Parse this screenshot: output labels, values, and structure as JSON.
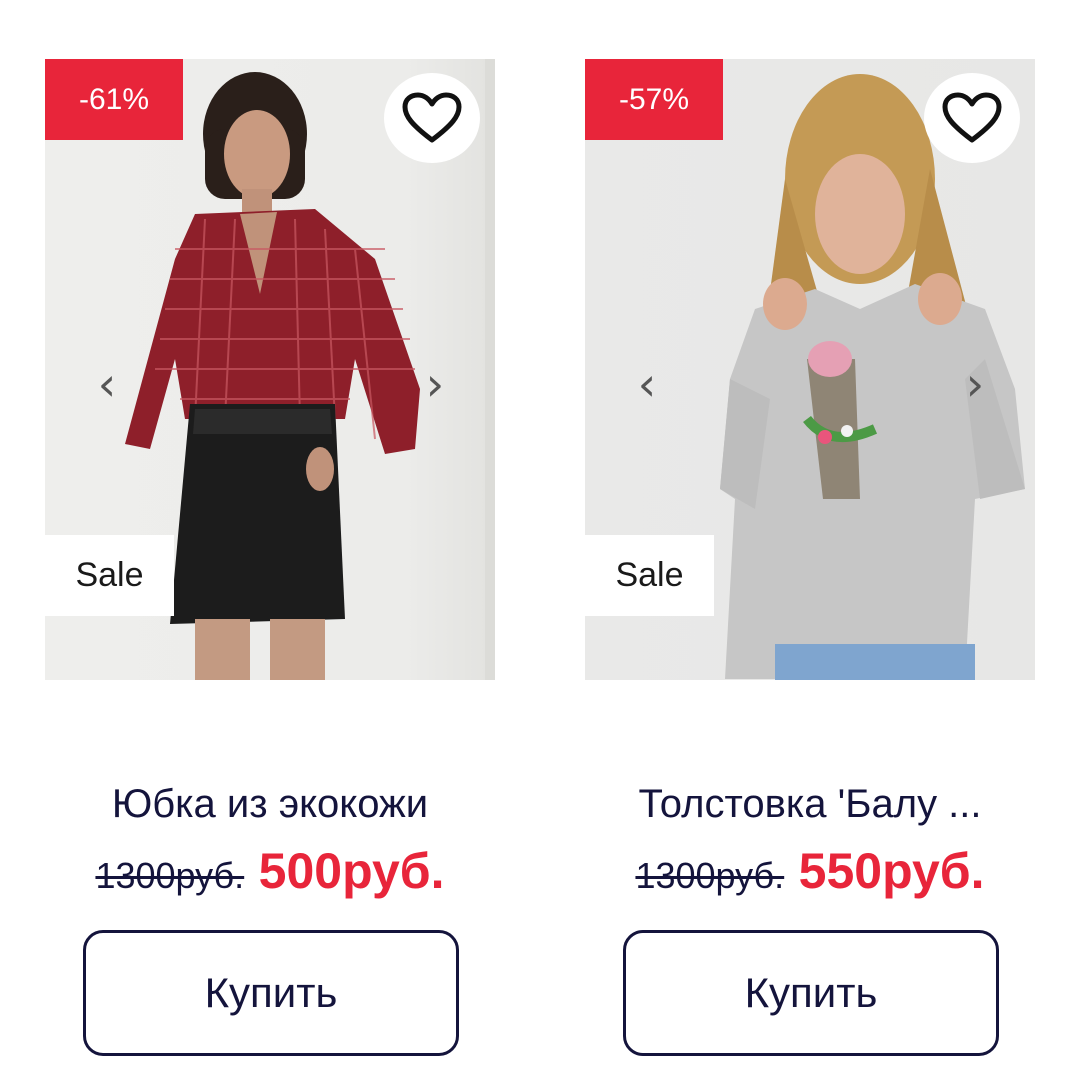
{
  "products": [
    {
      "discount": "-61%",
      "tag": "Sale",
      "title": "Юбка из экокожи",
      "old_price": "1300руб.",
      "new_price": "500руб.",
      "buy_label": "Купить",
      "icons": {
        "favorite": "heart-outline",
        "prev": "chevron-left",
        "next": "chevron-right"
      },
      "arrows": {
        "prev": "‹",
        "next": "›"
      }
    },
    {
      "discount": "-57%",
      "tag": "Sale",
      "title": "Толстовка 'Балу ...",
      "old_price": "1300руб.",
      "new_price": "550руб.",
      "buy_label": "Купить",
      "icons": {
        "favorite": "heart-outline",
        "prev": "chevron-left",
        "next": "chevron-right"
      },
      "arrows": {
        "prev": "‹",
        "next": "›"
      }
    }
  ],
  "colors": {
    "accent_red": "#e8253a",
    "text_navy": "#14143c",
    "button_border": "#14143c"
  }
}
